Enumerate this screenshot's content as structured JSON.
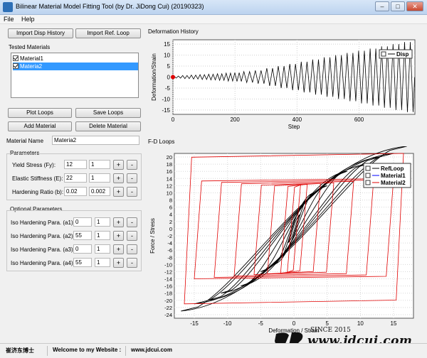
{
  "window": {
    "title": "Bilinear Material Model Fitting Tool (by Dr. JiDong Cui) (20190323)",
    "minimize": "–",
    "maximize": "□",
    "close": "✕"
  },
  "menu": {
    "items": [
      "File",
      "Help"
    ]
  },
  "left_panel": {
    "import_disp_label": "Import Disp History",
    "import_ref_label": "Import Ref. Loop",
    "tested_materials_label": "Tested Materials",
    "materials": [
      {
        "label": "Material1",
        "checked": true,
        "selected": false
      },
      {
        "label": "Materia2",
        "checked": true,
        "selected": true
      }
    ],
    "plot_loops_label": "Plot Loops",
    "save_loops_label": "Save Loops",
    "add_material_label": "Add Material",
    "delete_material_label": "Delete Material",
    "material_name_label": "Material Name",
    "material_name_value": "Materia2",
    "parameters_label": "Parameters",
    "parameters": [
      {
        "label": "Yield Stress (Fy):",
        "value": "12",
        "step": "1"
      },
      {
        "label": "Elastic Stiffness (E):",
        "value": "22",
        "step": "1"
      },
      {
        "label": "Hardening Ratio (b):",
        "value": "0.02",
        "step": "0.002"
      }
    ],
    "optional_label": "Optional Parameters",
    "optional_parameters": [
      {
        "label": "Iso Hardening Para. (a1):",
        "value": "0",
        "step": "1"
      },
      {
        "label": "Iso Hardening Para. (a2):",
        "value": "55",
        "step": "1"
      },
      {
        "label": "Iso Hardening Para. (a3):",
        "value": "0",
        "step": "1"
      },
      {
        "label": "Iso Hardening Para. (a4):",
        "value": "55",
        "step": "1"
      }
    ],
    "plus": "+",
    "minus": "-"
  },
  "charts": {
    "deformation_title": "Deformation History",
    "fd_title": "F-D Loops",
    "colors": {
      "disp": "#000000",
      "refloop": "#000000",
      "material1": "#0000ff",
      "material2": "#e00000",
      "marker": "#e00000"
    }
  },
  "chart_data": [
    {
      "type": "line",
      "title": "Deformation History",
      "xlabel": "Step",
      "ylabel": "Deformation/Strain",
      "xlim": [
        0,
        780
      ],
      "ylim": [
        -17,
        17
      ],
      "x_ticks": [
        0,
        200,
        400,
        600
      ],
      "y_ticks": [
        -15,
        -10,
        -5,
        0,
        5,
        10,
        15
      ],
      "legend": {
        "position": "top-right",
        "entries": [
          "Disp"
        ]
      },
      "series": [
        {
          "name": "Disp",
          "cycles": [
            {
              "start_step": 0,
              "amplitudes": [
                0.5,
                0.5,
                0.7,
                0.7,
                0.9,
                0.9,
                1.1,
                1.1,
                1.3,
                1.3,
                1.5,
                1.5,
                1.8,
                1.8,
                2,
                2
              ],
              "period": 14
            },
            {
              "start_step": 224,
              "amplitudes": [
                2.5,
                2.5,
                3,
                3,
                4,
                4,
                5,
                5,
                6,
                6,
                7,
                7,
                8,
                8,
                9,
                9,
                10,
                10,
                11,
                11,
                12,
                12,
                13,
                13,
                14,
                14,
                15,
                15,
                16,
                16
              ],
              "period": 18.5
            }
          ],
          "end_step": 780
        }
      ],
      "markers": [
        {
          "x": 0,
          "y": 0
        }
      ]
    },
    {
      "type": "line",
      "title": "F-D Loops",
      "xlabel": "Deformation / Strain",
      "ylabel": "Force  /  Stress",
      "xlim": [
        -18,
        18
      ],
      "ylim": [
        -25,
        21
      ],
      "x_ticks": [
        -15,
        -10,
        -5,
        0,
        5,
        10,
        15
      ],
      "y_ticks": [
        -24,
        -22,
        -20,
        -18,
        -16,
        -14,
        -12,
        -10,
        -8,
        -6,
        -4,
        -2,
        0,
        2,
        4,
        6,
        8,
        10,
        12,
        14,
        16,
        18,
        20
      ],
      "legend": {
        "position": "top-right",
        "entries": [
          "RefLoop",
          "Material1",
          "Material2"
        ]
      },
      "series": [
        {
          "name": "RefLoop",
          "loops": [
            {
              "amplitude": 1,
              "force": 4
            },
            {
              "amplitude": 2,
              "force": 8
            },
            {
              "amplitude": 3,
              "force": 10
            },
            {
              "amplitude": 5,
              "force": 12
            },
            {
              "amplitude": 8,
              "force": 16
            },
            {
              "amplitude": 11,
              "force": 18
            },
            {
              "amplitude": 13,
              "force": 20
            },
            {
              "amplitude": 15,
              "force": 21
            },
            {
              "amplitude": 17,
              "force": 23
            }
          ]
        },
        {
          "name": "Material2",
          "loops": [
            {
              "amplitude": 1,
              "force": 12.2
            },
            {
              "amplitude": 2,
              "force": 12.4
            },
            {
              "amplitude": 4,
              "force": 12.6
            },
            {
              "amplitude": 6,
              "force": 12.8
            },
            {
              "amplitude": 9,
              "force": 13.2
            },
            {
              "amplitude": 12,
              "force": 13.6
            },
            {
              "amplitude": 15,
              "force": 14
            },
            {
              "amplitude": 16.5,
              "force": 21
            }
          ]
        }
      ]
    }
  ],
  "status": {
    "author": "崔济东博士",
    "welcome": "Welcome to my Website :",
    "url": "www.jdcui.com",
    "watermark_since": "SINCE 2015",
    "watermark_url": "www.jdcui.com"
  }
}
